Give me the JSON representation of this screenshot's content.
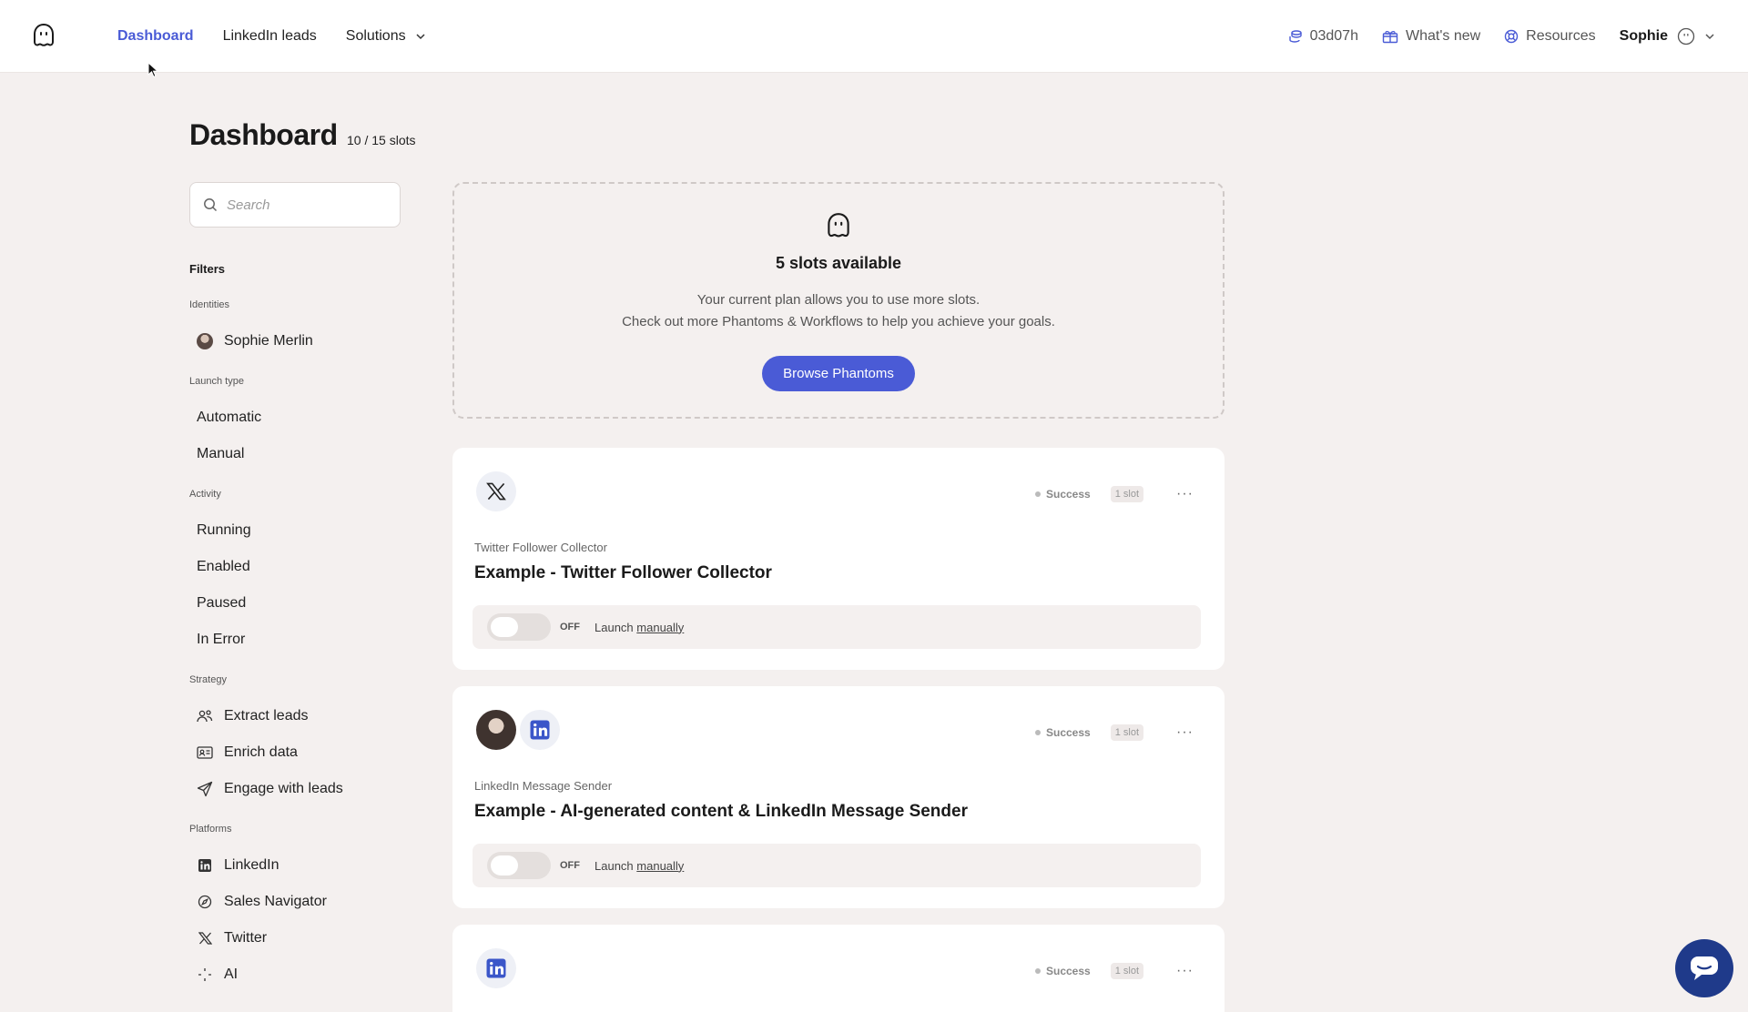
{
  "topbar": {
    "nav": [
      {
        "label": "Dashboard",
        "active": true
      },
      {
        "label": "LinkedIn leads",
        "active": false
      },
      {
        "label": "Solutions",
        "active": false
      }
    ],
    "time_remaining": "03d07h",
    "whats_new": "What's new",
    "resources": "Resources",
    "user_name": "Sophie"
  },
  "page": {
    "title": "Dashboard",
    "slots": "10 / 15 slots"
  },
  "search": {
    "placeholder": "Search"
  },
  "sidebar": {
    "filters_title": "Filters",
    "identities_label": "Identities",
    "identity": "Sophie Merlin",
    "launch_type_label": "Launch type",
    "launch_types": [
      "Automatic",
      "Manual"
    ],
    "activity_label": "Activity",
    "activity": [
      "Running",
      "Enabled",
      "Paused",
      "In Error"
    ],
    "strategy_label": "Strategy",
    "strategy": [
      "Extract leads",
      "Enrich data",
      "Engage with leads"
    ],
    "platforms_label": "Platforms",
    "platforms": [
      "LinkedIn",
      "Sales Navigator",
      "Twitter",
      "AI"
    ]
  },
  "slots_card": {
    "title": "5 slots available",
    "line1": "Your current plan allows you to use more slots.",
    "line2": "Check out more Phantoms & Workflows to help you achieve your goals.",
    "button": "Browse Phantoms"
  },
  "cards": [
    {
      "kind": "Twitter Follower Collector",
      "name": "Example - Twitter Follower Collector",
      "status": "Success",
      "slot": "1 slot",
      "toggle": "OFF",
      "launch_prefix": "Launch",
      "launch_link": "manually"
    },
    {
      "kind": "LinkedIn Message Sender",
      "name": "Example - AI-generated content & LinkedIn Message Sender",
      "status": "Success",
      "slot": "1 slot",
      "toggle": "OFF",
      "launch_prefix": "Launch",
      "launch_link": "manually"
    },
    {
      "status": "Success",
      "slot": "1 slot"
    }
  ],
  "colors": {
    "accent": "#4a5bd6",
    "background": "#f4f0ef",
    "chat": "#1f3a8a"
  }
}
